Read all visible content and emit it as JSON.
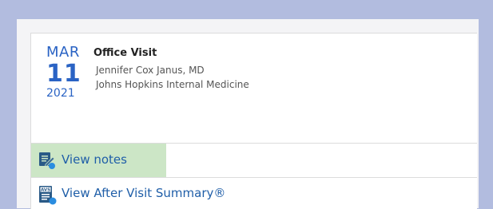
{
  "appointment": {
    "month": "MAR",
    "day": "11",
    "year": "2021",
    "visit_type": "Office Visit",
    "provider": "Jennifer Cox Janus, MD",
    "department": "Johns Hopkins Internal Medicine"
  },
  "actions": {
    "view_notes_label": "View notes",
    "view_avs_label": "View After Visit Summary®"
  },
  "icons": {
    "notes": "notes-pen-icon",
    "avs": "avs-document-icon"
  },
  "colors": {
    "page_background": "#b2bcdf",
    "accent_blue": "#2a63c4",
    "link_blue": "#1f5ea8",
    "notes_highlight": "#cce6c6"
  }
}
